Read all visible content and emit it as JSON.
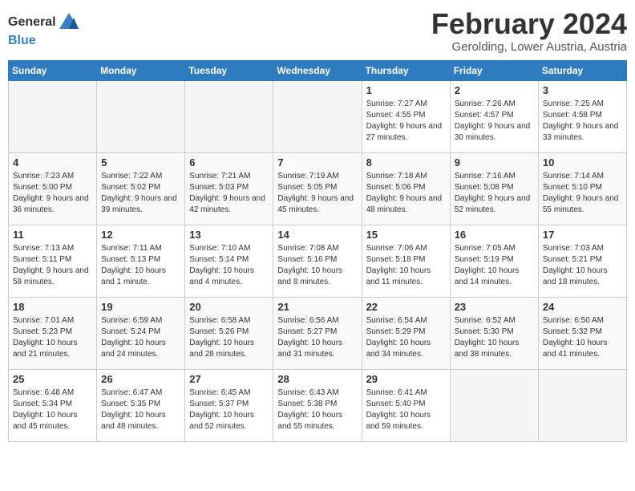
{
  "header": {
    "logo_general": "General",
    "logo_blue": "Blue",
    "month_year": "February 2024",
    "location": "Gerolding, Lower Austria, Austria"
  },
  "weekdays": [
    "Sunday",
    "Monday",
    "Tuesday",
    "Wednesday",
    "Thursday",
    "Friday",
    "Saturday"
  ],
  "weeks": [
    [
      {
        "day": "",
        "info": ""
      },
      {
        "day": "",
        "info": ""
      },
      {
        "day": "",
        "info": ""
      },
      {
        "day": "",
        "info": ""
      },
      {
        "day": "1",
        "info": "Sunrise: 7:27 AM\nSunset: 4:55 PM\nDaylight: 9 hours and 27 minutes."
      },
      {
        "day": "2",
        "info": "Sunrise: 7:26 AM\nSunset: 4:57 PM\nDaylight: 9 hours and 30 minutes."
      },
      {
        "day": "3",
        "info": "Sunrise: 7:25 AM\nSunset: 4:58 PM\nDaylight: 9 hours and 33 minutes."
      }
    ],
    [
      {
        "day": "4",
        "info": "Sunrise: 7:23 AM\nSunset: 5:00 PM\nDaylight: 9 hours and 36 minutes."
      },
      {
        "day": "5",
        "info": "Sunrise: 7:22 AM\nSunset: 5:02 PM\nDaylight: 9 hours and 39 minutes."
      },
      {
        "day": "6",
        "info": "Sunrise: 7:21 AM\nSunset: 5:03 PM\nDaylight: 9 hours and 42 minutes."
      },
      {
        "day": "7",
        "info": "Sunrise: 7:19 AM\nSunset: 5:05 PM\nDaylight: 9 hours and 45 minutes."
      },
      {
        "day": "8",
        "info": "Sunrise: 7:18 AM\nSunset: 5:06 PM\nDaylight: 9 hours and 48 minutes."
      },
      {
        "day": "9",
        "info": "Sunrise: 7:16 AM\nSunset: 5:08 PM\nDaylight: 9 hours and 52 minutes."
      },
      {
        "day": "10",
        "info": "Sunrise: 7:14 AM\nSunset: 5:10 PM\nDaylight: 9 hours and 55 minutes."
      }
    ],
    [
      {
        "day": "11",
        "info": "Sunrise: 7:13 AM\nSunset: 5:11 PM\nDaylight: 9 hours and 58 minutes."
      },
      {
        "day": "12",
        "info": "Sunrise: 7:11 AM\nSunset: 5:13 PM\nDaylight: 10 hours and 1 minute."
      },
      {
        "day": "13",
        "info": "Sunrise: 7:10 AM\nSunset: 5:14 PM\nDaylight: 10 hours and 4 minutes."
      },
      {
        "day": "14",
        "info": "Sunrise: 7:08 AM\nSunset: 5:16 PM\nDaylight: 10 hours and 8 minutes."
      },
      {
        "day": "15",
        "info": "Sunrise: 7:06 AM\nSunset: 5:18 PM\nDaylight: 10 hours and 11 minutes."
      },
      {
        "day": "16",
        "info": "Sunrise: 7:05 AM\nSunset: 5:19 PM\nDaylight: 10 hours and 14 minutes."
      },
      {
        "day": "17",
        "info": "Sunrise: 7:03 AM\nSunset: 5:21 PM\nDaylight: 10 hours and 18 minutes."
      }
    ],
    [
      {
        "day": "18",
        "info": "Sunrise: 7:01 AM\nSunset: 5:23 PM\nDaylight: 10 hours and 21 minutes."
      },
      {
        "day": "19",
        "info": "Sunrise: 6:59 AM\nSunset: 5:24 PM\nDaylight: 10 hours and 24 minutes."
      },
      {
        "day": "20",
        "info": "Sunrise: 6:58 AM\nSunset: 5:26 PM\nDaylight: 10 hours and 28 minutes."
      },
      {
        "day": "21",
        "info": "Sunrise: 6:56 AM\nSunset: 5:27 PM\nDaylight: 10 hours and 31 minutes."
      },
      {
        "day": "22",
        "info": "Sunrise: 6:54 AM\nSunset: 5:29 PM\nDaylight: 10 hours and 34 minutes."
      },
      {
        "day": "23",
        "info": "Sunrise: 6:52 AM\nSunset: 5:30 PM\nDaylight: 10 hours and 38 minutes."
      },
      {
        "day": "24",
        "info": "Sunrise: 6:50 AM\nSunset: 5:32 PM\nDaylight: 10 hours and 41 minutes."
      }
    ],
    [
      {
        "day": "25",
        "info": "Sunrise: 6:48 AM\nSunset: 5:34 PM\nDaylight: 10 hours and 45 minutes."
      },
      {
        "day": "26",
        "info": "Sunrise: 6:47 AM\nSunset: 5:35 PM\nDaylight: 10 hours and 48 minutes."
      },
      {
        "day": "27",
        "info": "Sunrise: 6:45 AM\nSunset: 5:37 PM\nDaylight: 10 hours and 52 minutes."
      },
      {
        "day": "28",
        "info": "Sunrise: 6:43 AM\nSunset: 5:38 PM\nDaylight: 10 hours and 55 minutes."
      },
      {
        "day": "29",
        "info": "Sunrise: 6:41 AM\nSunset: 5:40 PM\nDaylight: 10 hours and 59 minutes."
      },
      {
        "day": "",
        "info": ""
      },
      {
        "day": "",
        "info": ""
      }
    ]
  ]
}
